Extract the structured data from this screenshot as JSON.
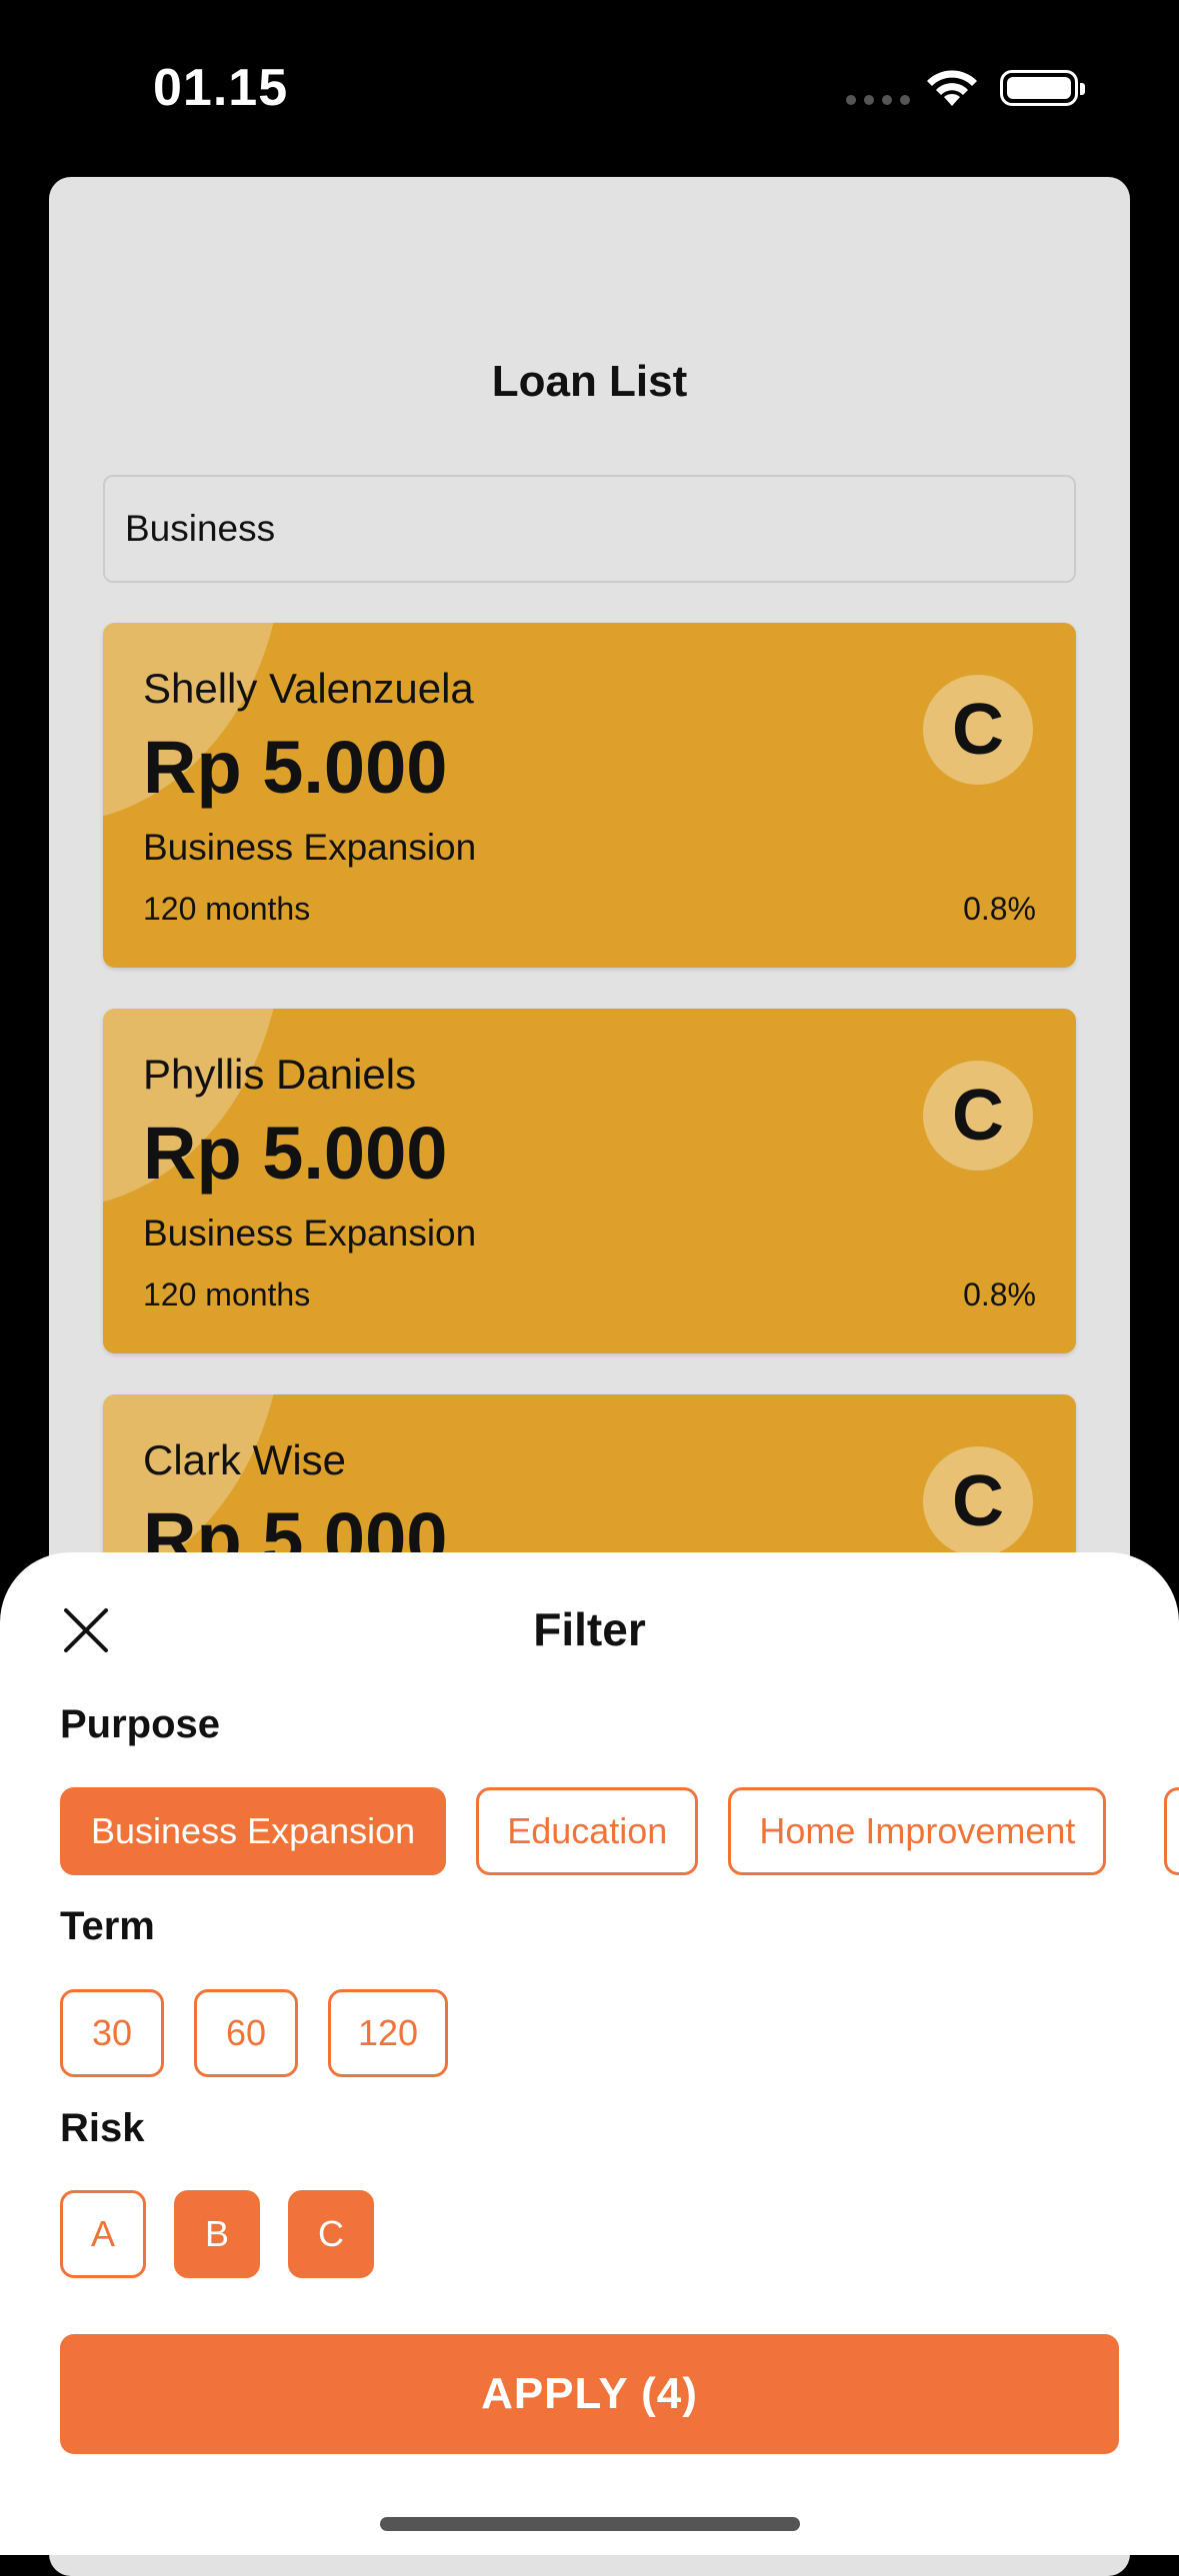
{
  "status_bar": {
    "time": "01.15"
  },
  "page": {
    "title": "Loan List",
    "search": {
      "value": "Business",
      "placeholder": ""
    }
  },
  "loans": [
    {
      "name": "Shelly Valenzuela",
      "amount": "Rp 5.000",
      "purpose": "Business Expansion",
      "term": "120 months",
      "rate": "0.8%",
      "grade": "C"
    },
    {
      "name": "Phyllis Daniels",
      "amount": "Rp 5.000",
      "purpose": "Business Expansion",
      "term": "120 months",
      "rate": "0.8%",
      "grade": "C"
    },
    {
      "name": "Clark Wise",
      "amount": "Rp 5.000",
      "purpose": "",
      "term": "",
      "rate": "",
      "grade": "C"
    }
  ],
  "filter": {
    "title": "Filter",
    "purpose_label": "Purpose",
    "purpose_options": [
      {
        "label": "Business Expansion",
        "selected": true
      },
      {
        "label": "Education",
        "selected": false
      },
      {
        "label": "Home Improvement",
        "selected": false
      }
    ],
    "term_label": "Term",
    "term_options": [
      {
        "label": "30",
        "selected": false
      },
      {
        "label": "60",
        "selected": false
      },
      {
        "label": "120",
        "selected": true
      }
    ],
    "risk_label": "Risk",
    "risk_options": [
      {
        "label": "A",
        "selected": false
      },
      {
        "label": "B",
        "selected": true
      },
      {
        "label": "C",
        "selected": true
      }
    ],
    "apply_label": "APPLY (4)"
  },
  "colors": {
    "accent": "#f0743a",
    "card": "#dca02b",
    "background": "#e2e2e2"
  },
  "icons": [
    "wifi-icon",
    "battery-icon",
    "close-icon"
  ]
}
